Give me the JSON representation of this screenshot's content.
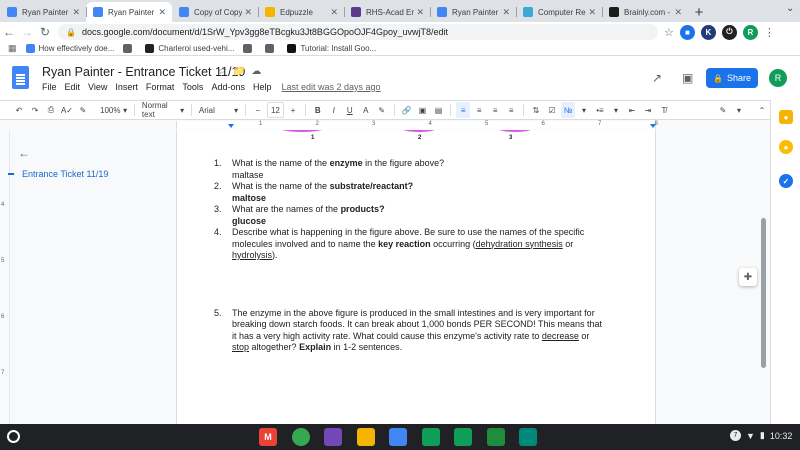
{
  "browser": {
    "tabs": [
      {
        "title": "Ryan Painter - E",
        "favicon_color": "#4285f4",
        "active": false
      },
      {
        "title": "Ryan Painter - E",
        "favicon_color": "#4285f4",
        "active": true
      },
      {
        "title": "Copy of Copy of",
        "favicon_color": "#4285f4",
        "active": false
      },
      {
        "title": "Edpuzzle",
        "favicon_color": "#f5b400",
        "active": false
      },
      {
        "title": "RHS-Acad Engl",
        "favicon_color": "#5b3a8a",
        "active": false
      },
      {
        "title": "Ryan Painter - E",
        "favicon_color": "#4285f4",
        "active": false
      },
      {
        "title": "Computer Resc",
        "favicon_color": "#3ba8d8",
        "active": false
      },
      {
        "title": "Brainly.com - Fc",
        "favicon_color": "#1c1c1c",
        "active": false
      }
    ],
    "new_tab": "+",
    "url": "docs.google.com/document/d/1SrW_Ypv3gg8eTBcgku3Jt8BGGOpoOJF4Gpoy_uvwjT8/edit",
    "bookmarks": [
      {
        "label": "How effectively doe...",
        "color": "#4285f4"
      },
      {
        "label": "",
        "color": "#5f6368"
      },
      {
        "label": "Charleroi used-vehi...",
        "color": "#222"
      },
      {
        "label": "",
        "color": "#5f6368"
      },
      {
        "label": "",
        "color": "#5f6368"
      },
      {
        "label": "Tutorial: Install Goo...",
        "color": "#111"
      }
    ]
  },
  "docs": {
    "title": "Ryan Painter - Entrance Ticket 11/19",
    "menus": [
      "File",
      "Edit",
      "View",
      "Insert",
      "Format",
      "Tools",
      "Add-ons",
      "Help"
    ],
    "last_edit": "Last edit was 2 days ago",
    "share_label": "Share",
    "avatar_letter": "R",
    "toolbar": {
      "zoom": "100%",
      "style": "Normal text",
      "font": "Arial",
      "font_size": "12"
    },
    "outline": {
      "item": "Entrance Ticket 11/19"
    },
    "ruler_numbers": [
      "1",
      "2",
      "3",
      "4",
      "5",
      "6",
      "7",
      "8"
    ],
    "vruler_numbers": [
      "4",
      "5",
      "6",
      "7"
    ],
    "figure_labels": [
      "1",
      "2",
      "3"
    ],
    "questions": [
      {
        "num": "1.",
        "pre": "What is the name of the ",
        "bold": "enzyme",
        "post": " in the figure above?",
        "answer": "maltase",
        "answer_bold": false
      },
      {
        "num": "2.",
        "pre": "What is the name of the ",
        "bold": "substrate/reactant?",
        "post": "",
        "answer": "maltose",
        "answer_bold": true
      },
      {
        "num": "3.",
        "pre": "What are the names of the ",
        "bold": "products?",
        "post": "",
        "answer": "glucose",
        "answer_bold": true
      }
    ],
    "q4": {
      "num": "4.",
      "pre": "Describe what is happening in the figure above. Be sure to use the names of the specific molecules involved and to name the ",
      "bold": "key reaction",
      "mid": " occurring (",
      "link1": "dehydration synthesis",
      "or": " or ",
      "link2": "hydrolysis",
      "end": ")."
    },
    "q5": {
      "num": "5.",
      "pre": "The enzyme in the above figure is produced in the small intestines and is very important for breaking down starch foods. It can break about 1,000 bonds PER SECOND! This means that it has a very high activity rate. What could cause this enzyme's activity rate to ",
      "u1": "decrease",
      "or": " or ",
      "u2": "stop",
      "mid": " altogether? ",
      "bold": "Explain",
      "end": " in 1-2 sentences."
    }
  },
  "shelf": {
    "apps": [
      {
        "name": "gmail-icon",
        "label": "M",
        "color": "#ea4335"
      },
      {
        "name": "chrome-icon",
        "label": "",
        "color": "#34a853"
      },
      {
        "name": "forms-icon",
        "label": "",
        "color": "#7248b9"
      },
      {
        "name": "keep-icon",
        "label": "",
        "color": "#f4b400"
      },
      {
        "name": "docs-icon",
        "label": "",
        "color": "#4285f4"
      },
      {
        "name": "drive-icon",
        "label": "",
        "color": "#0f9d58"
      },
      {
        "name": "sheets-icon",
        "label": "",
        "color": "#0f9d58"
      },
      {
        "name": "classroom-icon",
        "label": "",
        "color": "#1e8e3e"
      },
      {
        "name": "meet-icon",
        "label": "",
        "color": "#00897b"
      }
    ],
    "time": "10:32",
    "badge": "7"
  }
}
